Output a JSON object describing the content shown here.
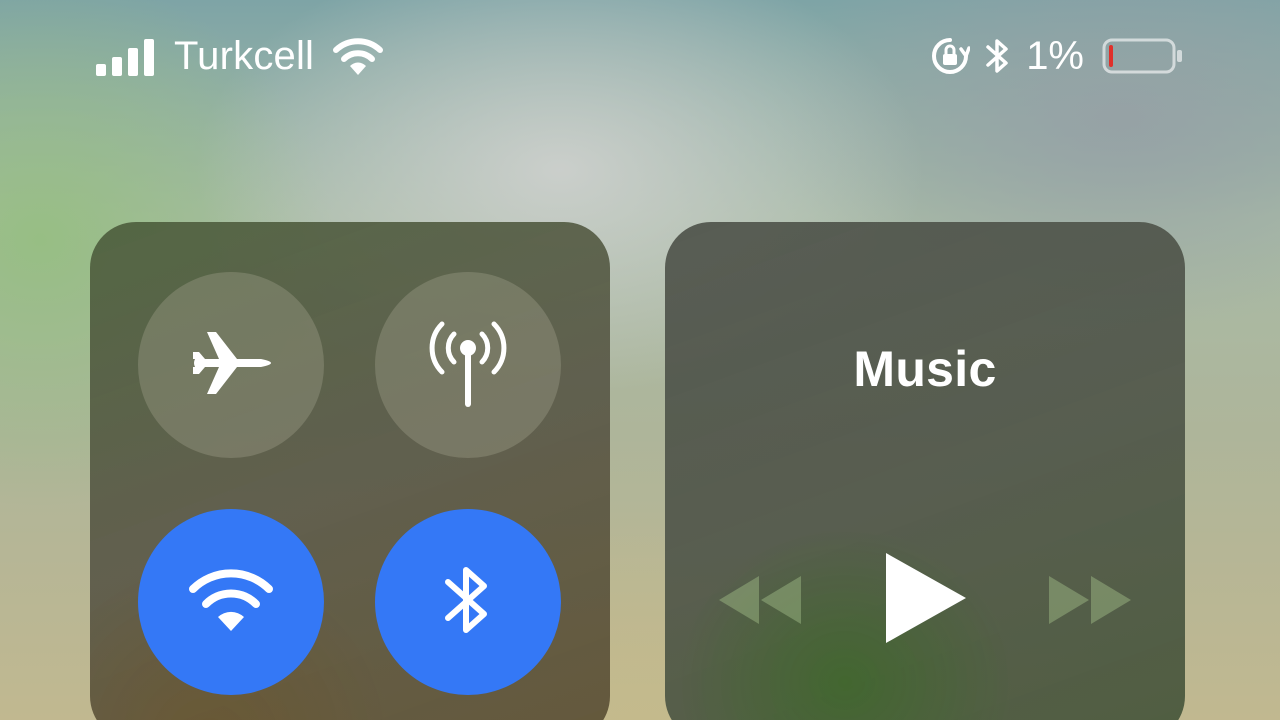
{
  "status_bar": {
    "carrier": "Turkcell",
    "battery_percent": "1%",
    "battery_level": 0.01,
    "icons": [
      "signal-bars-icon",
      "wifi-icon",
      "orientation-lock-icon",
      "bluetooth-icon",
      "battery-icon"
    ]
  },
  "connectivity": {
    "toggles": [
      {
        "name": "airplane-mode",
        "icon": "airplane-icon",
        "on": false
      },
      {
        "name": "cellular-data",
        "icon": "antenna-icon",
        "on": false
      },
      {
        "name": "wifi",
        "icon": "wifi-icon",
        "on": true
      },
      {
        "name": "bluetooth",
        "icon": "bluetooth-icon",
        "on": true
      }
    ],
    "active_color": "#3478f6"
  },
  "music": {
    "title": "Music",
    "controls": [
      "rewind-icon",
      "play-icon",
      "fast-forward-icon"
    ]
  }
}
